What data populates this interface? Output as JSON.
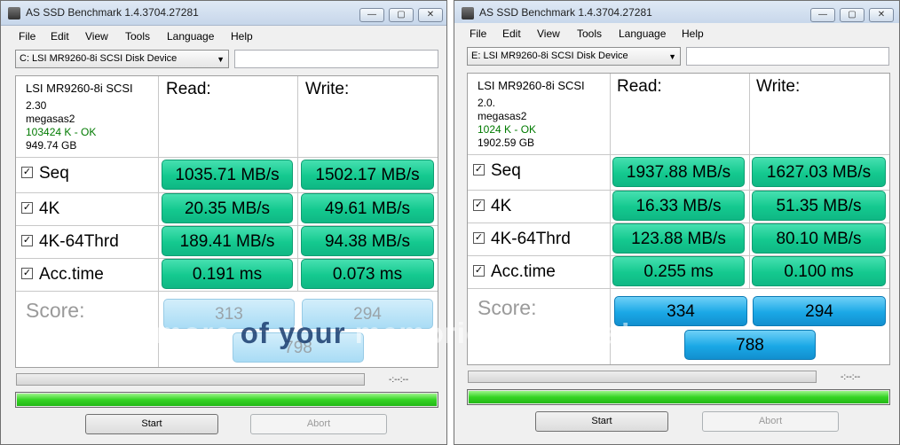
{
  "windows": [
    {
      "title": "AS SSD Benchmark 1.4.3704.27281",
      "menu": [
        "File",
        "Edit",
        "View",
        "Tools",
        "Language",
        "Help"
      ],
      "drive": "C: LSI MR9260-8i SCSI Disk Device",
      "path": "",
      "info": {
        "model": "LSI MR9260-8i SCSI",
        "firmware": "2.30",
        "driver": "megasas2",
        "alignment": "103424 K - OK",
        "size": "949.74 GB"
      },
      "read_header": "Read:",
      "write_header": "Write:",
      "rows": [
        {
          "label": "Seq",
          "checked": true,
          "read": "1035.71 MB/s",
          "write": "1502.17 MB/s"
        },
        {
          "label": "4K",
          "checked": true,
          "read": "20.35 MB/s",
          "write": "49.61 MB/s"
        },
        {
          "label": "4K-64Thrd",
          "checked": true,
          "read": "189.41 MB/s",
          "write": "94.38 MB/s"
        },
        {
          "label": "Acc.time",
          "checked": true,
          "read": "0.191 ms",
          "write": "0.073 ms"
        }
      ],
      "score_label": "Score:",
      "score_read": "313",
      "score_write": "294",
      "score_total": "798",
      "time": "-:--:--",
      "progress_fraction": 1.0,
      "start": "Start",
      "abort": "Abort"
    },
    {
      "title": "AS SSD Benchmark 1.4.3704.27281",
      "menu": [
        "File",
        "Edit",
        "View",
        "Tools",
        "Language",
        "Help"
      ],
      "drive": "E: LSI MR9260-8i SCSI Disk Device",
      "path": "",
      "info": {
        "model": "LSI MR9260-8i SCSI",
        "firmware": "2.0.",
        "driver": "megasas2",
        "alignment": "1024 K - OK",
        "size": "1902.59 GB"
      },
      "read_header": "Read:",
      "write_header": "Write:",
      "rows": [
        {
          "label": "Seq",
          "checked": true,
          "read": "1937.88 MB/s",
          "write": "1627.03 MB/s"
        },
        {
          "label": "4K",
          "checked": true,
          "read": "16.33 MB/s",
          "write": "51.35 MB/s"
        },
        {
          "label": "4K-64Thrd",
          "checked": true,
          "read": "123.88 MB/s",
          "write": "80.10 MB/s"
        },
        {
          "label": "Acc.time",
          "checked": true,
          "read": "0.255 ms",
          "write": "0.100 ms"
        }
      ],
      "score_label": "Score:",
      "score_read": "334",
      "score_write": "294",
      "score_total": "788",
      "time": "-:--:--",
      "progress_fraction": 1.0,
      "start": "Start",
      "abort": "Abort"
    }
  ],
  "watermark": {
    "before": "Protect more ",
    "highlight": "of your ",
    "after": "memories for less!"
  },
  "colors": {
    "result_green": "#14c98f",
    "score_blue": "#1aa8e6",
    "progress_green": "#35d424",
    "alignment_ok": "#007a00"
  }
}
